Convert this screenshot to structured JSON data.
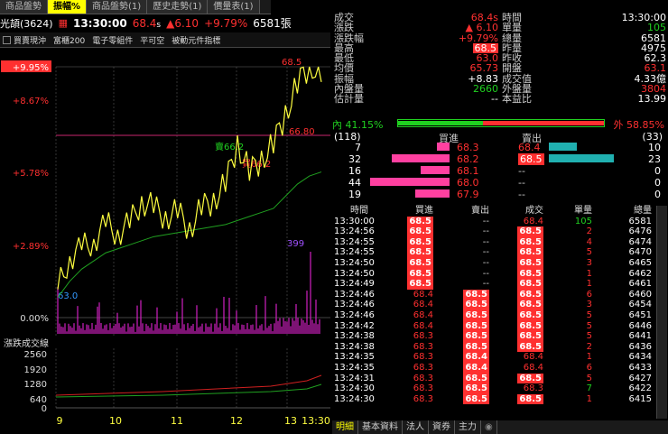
{
  "tabs": [
    "商品盤勢",
    "振幅%",
    "商品盤勢(1)",
    "歷史走勢(1)",
    "價量表(1)"
  ],
  "header": {
    "stock": "光頡(3624)",
    "time": "13:30:00",
    "price": "68.4",
    "price_flag": "s",
    "change": "▲6.10",
    "change_pct": "+9.79%",
    "volume": "6581",
    "vol_unit": "張"
  },
  "indicators": [
    "買賣現沖",
    "富櫃200",
    "電子零組件",
    "平可空",
    "被動元件指標"
  ],
  "chart": {
    "y_labels": [
      "+9.95%",
      "+8.67%",
      "+5.78%",
      "+2.89%",
      "0.00%"
    ],
    "ref_line_label": "66.80",
    "high_label": "68.5",
    "mid_label1": "賣66.2",
    "mid_label2": "買66.2",
    "low_label": "63.0",
    "vol_peak": "399",
    "vol_title": "漲跌成交線",
    "vol_labels": [
      "2560",
      "1920",
      "1280",
      "640",
      "0"
    ],
    "x_labels": [
      "9",
      "10",
      "11",
      "12",
      "13",
      "13:30"
    ]
  },
  "chart_data": {
    "type": "line",
    "title": "",
    "x": [
      "9:00",
      "9:10",
      "9:20",
      "9:30",
      "9:40",
      "9:50",
      "10:00",
      "10:15",
      "10:30",
      "10:45",
      "11:00",
      "11:15",
      "11:30",
      "11:45",
      "12:00",
      "12:10",
      "12:20",
      "12:30",
      "12:45",
      "13:00",
      "13:10",
      "13:20",
      "13:30"
    ],
    "series": [
      {
        "name": "",
        "values": [
          63.0,
          63.8,
          64.0,
          64.2,
          64.6,
          64.4,
          64.6,
          65.2,
          65.0,
          64.8,
          64.9,
          64.5,
          65.0,
          65.2,
          65.6,
          66.6,
          65.9,
          66.2,
          66.6,
          67.3,
          68.1,
          68.5,
          68.4
        ]
      }
    ],
    "avg": [
      62.8,
      63.2,
      63.5,
      63.7,
      63.9,
      64.0,
      64.1,
      64.2,
      64.3,
      64.35,
      64.4,
      64.45,
      64.5,
      64.55,
      64.6,
      64.7,
      64.8,
      64.9,
      65.0,
      65.3,
      65.6,
      65.8,
      65.9
    ],
    "ylim": [
      62.3,
      68.5
    ]
  },
  "quote": [
    [
      "成交",
      "68.4s",
      "時間",
      "13:30:00"
    ],
    [
      "漲跌",
      "▲ 6.10",
      "單量",
      "105"
    ],
    [
      "漲跌幅",
      "+9.79%",
      "總量",
      "6581"
    ],
    [
      "最高",
      "68.5",
      "昨量",
      "4975"
    ],
    [
      "最低",
      "63.0",
      "昨收",
      "62.3"
    ],
    [
      "均價",
      "65.73",
      "開盤",
      "63.1"
    ],
    [
      "振幅",
      "+8.83",
      "成交值",
      "4.33億"
    ],
    [
      "內盤量",
      "2660",
      "外盤量",
      "3804"
    ],
    [
      "估計量",
      "--",
      "本益比",
      "13.99"
    ]
  ],
  "ratio": {
    "in_label": "內",
    "in_pct": "41.15%",
    "out_label": "外",
    "out_pct": "58.85%"
  },
  "book": {
    "bid_total": "(118)",
    "ask_total": "(33)",
    "bid_head": "買進",
    "ask_head": "賣出",
    "rows": [
      {
        "bq": "7",
        "bp": "68.3",
        "ap": "68.4",
        "aq": "10",
        "bf": 0.16,
        "af": 0.43
      },
      {
        "bq": "32",
        "bp": "68.2",
        "ap": "68.5",
        "aq": "23",
        "bf": 0.73,
        "af": 1.0
      },
      {
        "bq": "16",
        "bp": "68.1",
        "ap": "--",
        "aq": "0",
        "bf": 0.36,
        "af": 0
      },
      {
        "bq": "44",
        "bp": "68.0",
        "ap": "--",
        "aq": "0",
        "bf": 1.0,
        "af": 0
      },
      {
        "bq": "19",
        "bp": "67.9",
        "ap": "--",
        "aq": "0",
        "bf": 0.43,
        "af": 0
      }
    ]
  },
  "ticks": {
    "headers": [
      "時間",
      "買進",
      "賣出",
      "成交",
      "單量",
      "總量"
    ],
    "rows": [
      [
        "13:30:00",
        "68.5",
        "--",
        "68.4",
        "105",
        "6581"
      ],
      [
        "13:24:56",
        "68.5",
        "--",
        "68.5",
        "2",
        "6476"
      ],
      [
        "13:24:55",
        "68.5",
        "--",
        "68.5",
        "4",
        "6474"
      ],
      [
        "13:24:55",
        "68.5",
        "--",
        "68.5",
        "5",
        "6470"
      ],
      [
        "13:24:50",
        "68.5",
        "--",
        "68.5",
        "3",
        "6465"
      ],
      [
        "13:24:50",
        "68.5",
        "--",
        "68.5",
        "1",
        "6462"
      ],
      [
        "13:24:49",
        "68.5",
        "--",
        "68.5",
        "1",
        "6461"
      ],
      [
        "13:24:46",
        "68.4",
        "68.5",
        "68.5",
        "6",
        "6460"
      ],
      [
        "13:24:46",
        "68.4",
        "68.5",
        "68.5",
        "3",
        "6454"
      ],
      [
        "13:24:46",
        "68.4",
        "68.5",
        "68.5",
        "5",
        "6451"
      ],
      [
        "13:24:42",
        "68.4",
        "68.5",
        "68.5",
        "5",
        "6446"
      ],
      [
        "13:24:38",
        "68.3",
        "68.5",
        "68.5",
        "5",
        "6441"
      ],
      [
        "13:24:38",
        "68.3",
        "68.5",
        "68.5",
        "2",
        "6436"
      ],
      [
        "13:24:35",
        "68.3",
        "68.4",
        "68.4",
        "1",
        "6434"
      ],
      [
        "13:24:35",
        "68.3",
        "68.4",
        "68.4",
        "6",
        "6433"
      ],
      [
        "13:24:31",
        "68.3",
        "68.5",
        "68.5",
        "5",
        "6427"
      ],
      [
        "13:24:30",
        "68.3",
        "68.5",
        "68.3",
        "7",
        "6422"
      ],
      [
        "13:24:30",
        "68.3",
        "68.5",
        "68.5",
        "1",
        "6415"
      ]
    ]
  },
  "bottom_tabs": [
    "明細",
    "基本資料",
    "法人",
    "資券",
    "主力"
  ]
}
